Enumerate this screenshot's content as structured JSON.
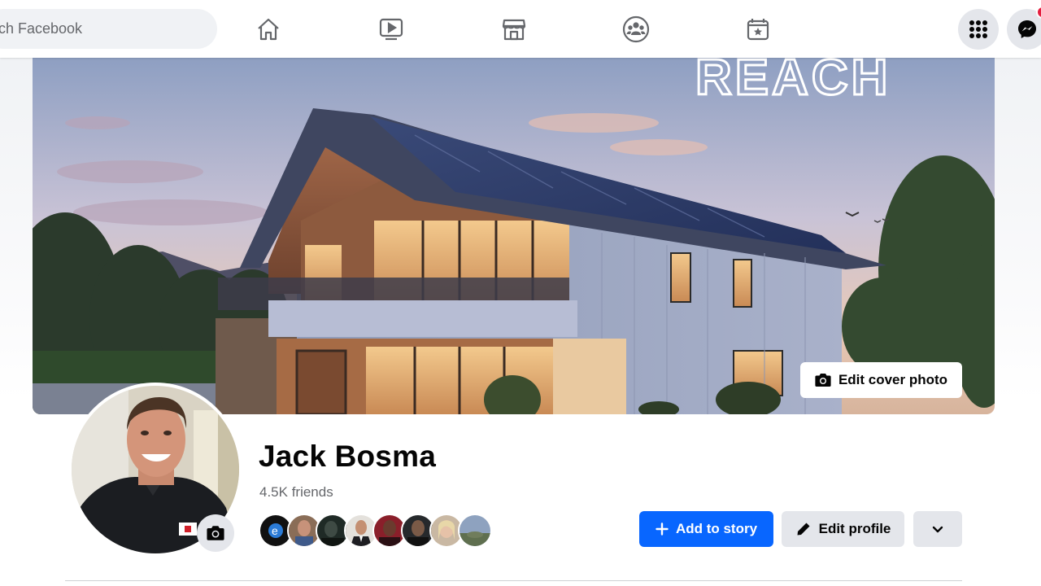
{
  "topbar": {
    "search_placeholder": "ch Facebook",
    "nav": [
      {
        "icon": "home-icon"
      },
      {
        "icon": "video-icon"
      },
      {
        "icon": "marketplace-icon"
      },
      {
        "icon": "groups-icon"
      },
      {
        "icon": "gaming-icon"
      }
    ],
    "menu_icon": "grid-menu-icon",
    "messenger_icon": "messenger-icon",
    "accent": "#0866ff",
    "badge_color": "#e41e3f"
  },
  "cover": {
    "watermark": "REACH",
    "edit_cover_label": "Edit cover photo"
  },
  "profile": {
    "name": "Jack Bosma",
    "friends_count": "4.5K friends",
    "actions": {
      "add_story": "Add to story",
      "edit_profile": "Edit profile"
    }
  }
}
